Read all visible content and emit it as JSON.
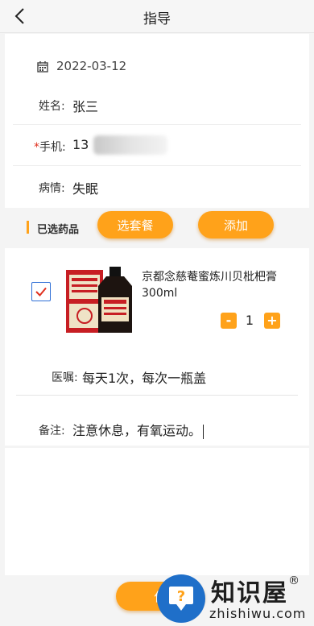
{
  "header": {
    "title": "指导",
    "back_icon": "chevron-left-icon"
  },
  "form": {
    "date": "2022-03-12",
    "name_label": "姓名:",
    "name_value": "张三",
    "phone_required_mark": "*",
    "phone_label": "手机:",
    "phone_value": "13",
    "condition_label": "病情:",
    "condition_value": "失眠"
  },
  "medicines": {
    "section_title": "已选药品",
    "package_button": "选套餐",
    "add_button": "添加",
    "items": [
      {
        "checked": true,
        "name": "京都念慈菴蜜炼川贝枇杷膏300ml",
        "quantity": "1",
        "minus_label": "-",
        "plus_label": "+"
      }
    ],
    "advice_label": "医嘱:",
    "advice_value": "每天1次，每次一瓶盖"
  },
  "remark": {
    "label": "备注:",
    "value": "注意休息，有氧运动。"
  },
  "footer": {
    "save_button": "保"
  },
  "watermark": {
    "text": "知识屋",
    "sub": "zhishiwu.com",
    "mark": "®"
  },
  "colors": {
    "accent": "#ffa21a",
    "checkbox": "#2f6fd6",
    "background": "#f4f4f4"
  }
}
